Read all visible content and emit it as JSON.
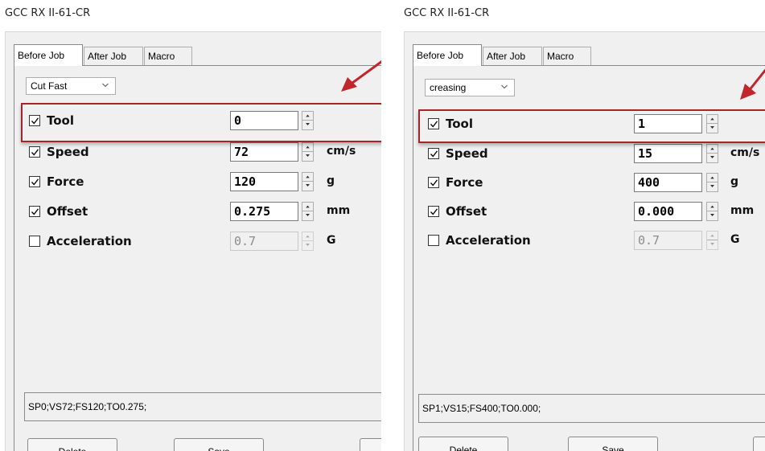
{
  "panels": [
    {
      "title": "GCC RX II-61-CR",
      "tabs": [
        "Before Job",
        "After Job",
        "Macro"
      ],
      "preset": "Cut Fast",
      "params": [
        {
          "label": "Tool",
          "checked": true,
          "value": "0",
          "unit": "",
          "enabled": true
        },
        {
          "label": "Speed",
          "checked": true,
          "value": "72",
          "unit": "cm/s",
          "enabled": true
        },
        {
          "label": "Force",
          "checked": true,
          "value": "120",
          "unit": "g",
          "enabled": true
        },
        {
          "label": "Offset",
          "checked": true,
          "value": "0.275",
          "unit": "mm",
          "enabled": true
        },
        {
          "label": "Acceleration",
          "checked": false,
          "value": "0.7",
          "unit": "G",
          "enabled": false
        }
      ],
      "command": "SP0;VS72;FS120;TO0.275;",
      "buttons": [
        "Delete",
        "Save"
      ]
    },
    {
      "title": "GCC RX II-61-CR",
      "tabs": [
        "Before Job",
        "After Job",
        "Macro"
      ],
      "preset": "creasing",
      "params": [
        {
          "label": "Tool",
          "checked": true,
          "value": "1",
          "unit": "",
          "enabled": true
        },
        {
          "label": "Speed",
          "checked": true,
          "value": "15",
          "unit": "cm/s",
          "enabled": true
        },
        {
          "label": "Force",
          "checked": true,
          "value": "400",
          "unit": "g",
          "enabled": true
        },
        {
          "label": "Offset",
          "checked": true,
          "value": "0.000",
          "unit": "mm",
          "enabled": true
        },
        {
          "label": "Acceleration",
          "checked": false,
          "value": "0.7",
          "unit": "G",
          "enabled": false
        }
      ],
      "command": "SP1;VS15;FS400;TO0.000;",
      "buttons": [
        "Delete",
        "Save"
      ]
    }
  ],
  "colors": {
    "highlight": "#a4262c",
    "arrow": "#c0262c",
    "dialog": "#f0f0f0"
  },
  "icons": {
    "combo_arrow": "chevron-down-icon",
    "check": "checkmark-icon",
    "spin": "spin-arrows-icon",
    "annotation": "red-arrow-icon"
  }
}
